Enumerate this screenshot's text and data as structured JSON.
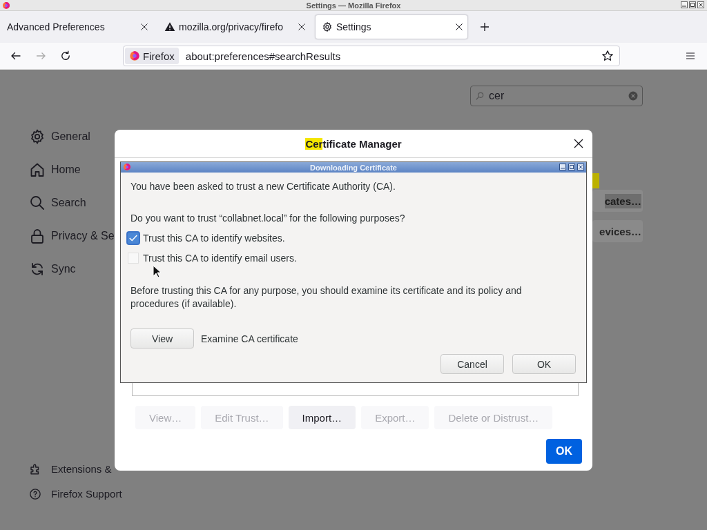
{
  "window": {
    "title": "Settings — Mozilla Firefox"
  },
  "tabs": [
    {
      "label": "Advanced Preferences",
      "selected": false
    },
    {
      "label": "mozilla.org/privacy/firefo",
      "selected": false
    },
    {
      "label": "Settings",
      "selected": true
    }
  ],
  "address_bar": {
    "identity": "Firefox",
    "url": "about:preferences#searchResults"
  },
  "search": {
    "value": "cer"
  },
  "sidebar": {
    "items": [
      {
        "label": "General"
      },
      {
        "label": "Home"
      },
      {
        "label": "Search"
      },
      {
        "label": "Privacy & Se"
      },
      {
        "label": "Sync"
      }
    ],
    "footer_items": [
      {
        "label": "Extensions &"
      },
      {
        "label": "Firefox Support"
      }
    ]
  },
  "background_buttons": [
    {
      "label": "cates…",
      "highlighted": true
    },
    {
      "label": "evices…",
      "highlighted": false
    }
  ],
  "certificate_manager": {
    "title_match": "Cer",
    "title_rest": "tificate Manager",
    "buttons": [
      {
        "label": "View…",
        "disabled": true
      },
      {
        "label": "Edit Trust…",
        "disabled": true
      },
      {
        "label": "Import…",
        "disabled": false
      },
      {
        "label": "Export…",
        "disabled": true
      },
      {
        "label": "Delete or Distrust…",
        "disabled": true
      }
    ],
    "ok": "OK"
  },
  "download_dialog": {
    "title": "Downloading Certificate",
    "intro": "You have been asked to trust a new Certificate Authority (CA).",
    "question": "Do you want to trust “collabnet.local” for the following purposes?",
    "options": [
      {
        "label": "Trust this CA to identify websites.",
        "checked": true
      },
      {
        "label": "Trust this CA to identify email users.",
        "checked": false
      }
    ],
    "note": "Before trusting this CA for any purpose, you should examine its certificate and its policy and procedures (if available).",
    "view_button": "View",
    "view_hint": "Examine CA certificate",
    "cancel": "Cancel",
    "ok": "OK"
  }
}
